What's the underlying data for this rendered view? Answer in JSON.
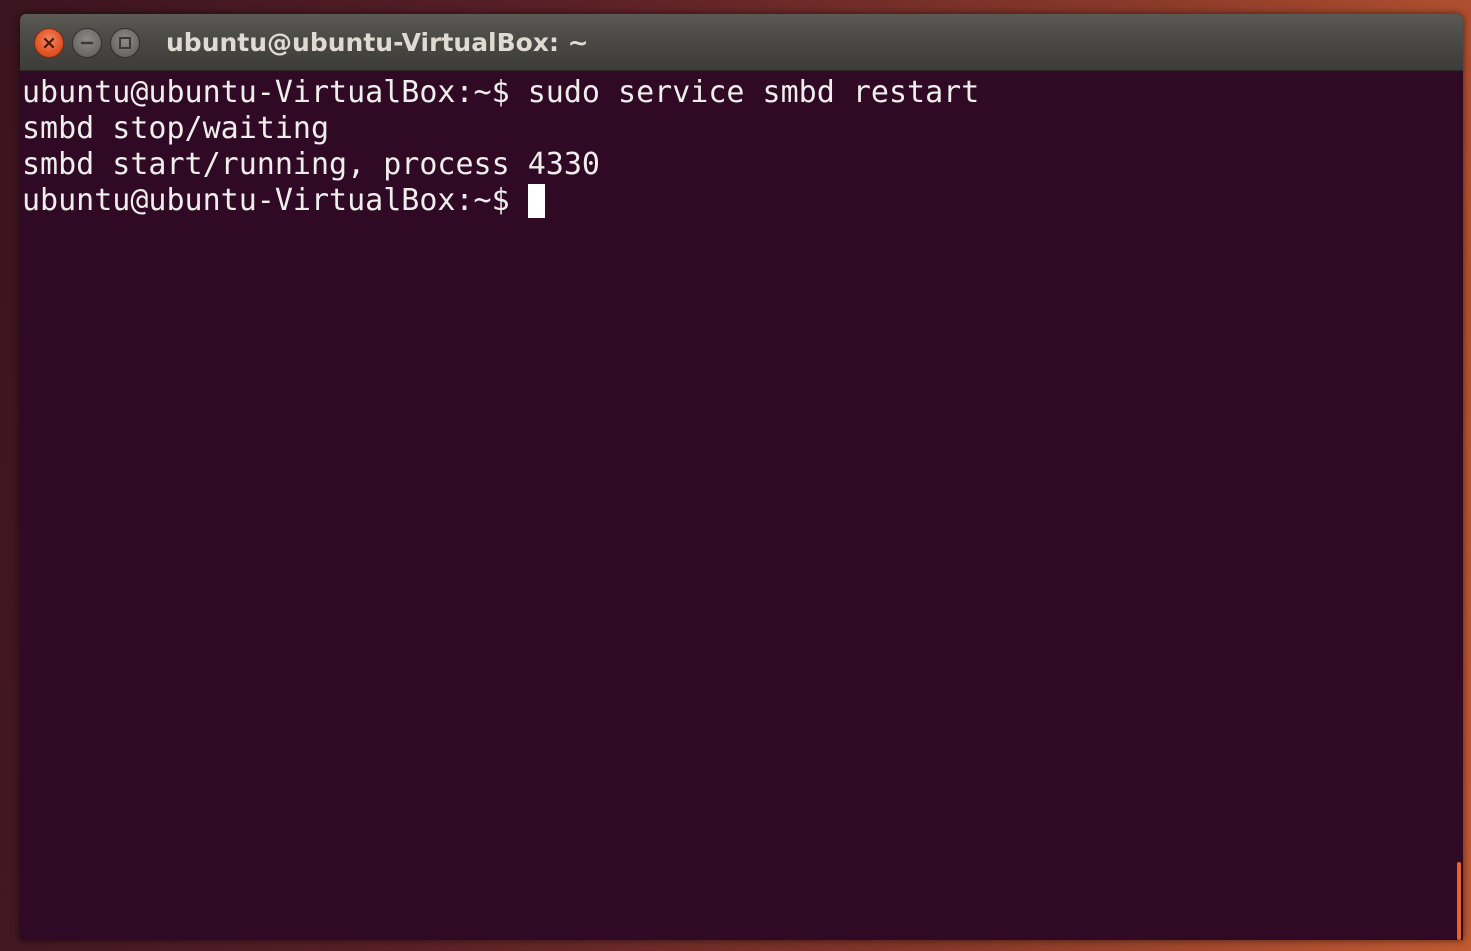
{
  "window": {
    "title": "ubuntu@ubuntu-VirtualBox: ~",
    "buttons": {
      "close_icon": "close-icon",
      "minimize_icon": "minimize-icon",
      "maximize_icon": "maximize-icon"
    }
  },
  "terminal": {
    "lines": [
      "ubuntu@ubuntu-VirtualBox:~$ sudo service smbd restart",
      "smbd stop/waiting",
      "smbd start/running, process 4330"
    ],
    "prompt": "ubuntu@ubuntu-VirtualBox:~$ ",
    "colors": {
      "background": "#300a24",
      "foreground": "#eeeeec",
      "cursor": "#ffffff",
      "scrollbar": "#e8632a"
    }
  }
}
